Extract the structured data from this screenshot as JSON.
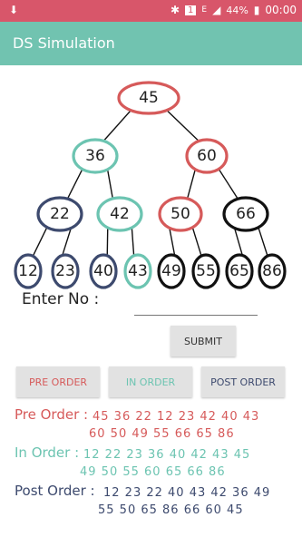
{
  "status_bar": {
    "sim_badge": "1",
    "network": "E",
    "battery": "44%",
    "time": "00:00"
  },
  "app": {
    "title": "DS Simulation"
  },
  "colors": {
    "status": "#d8566a",
    "app_bar": "#71c3b0",
    "red": "#d65a5a",
    "teal": "#6cc4b1",
    "navy": "#3d4a6e",
    "black": "#111111"
  },
  "tree": {
    "nodes": [
      {
        "value": "45",
        "color": "red"
      },
      {
        "value": "36",
        "color": "teal"
      },
      {
        "value": "60",
        "color": "red"
      },
      {
        "value": "22",
        "color": "navy"
      },
      {
        "value": "42",
        "color": "teal"
      },
      {
        "value": "50",
        "color": "red"
      },
      {
        "value": "66",
        "color": "black"
      },
      {
        "value": "12",
        "color": "navy"
      },
      {
        "value": "23",
        "color": "navy"
      },
      {
        "value": "40",
        "color": "navy"
      },
      {
        "value": "43",
        "color": "teal"
      },
      {
        "value": "49",
        "color": "black"
      },
      {
        "value": "55",
        "color": "black"
      },
      {
        "value": "65",
        "color": "black"
      },
      {
        "value": "86",
        "color": "black"
      }
    ]
  },
  "form": {
    "enter_label": "Enter No :",
    "input_value": "",
    "submit_label": "SUBMIT"
  },
  "buttons": {
    "pre_order": "PRE ORDER",
    "in_order": "IN ORDER",
    "post_order": "POST ORDER"
  },
  "results": {
    "pre_label": "Pre Order :",
    "pre_line1": "45 36 22 12 23 42 40 43",
    "pre_line2": "60 50 49 55 66 65 86",
    "in_label": "In Order :",
    "in_line1": "12 22 23 36 40 42 43 45",
    "in_line2": "49 50 55 60 65 66 86",
    "post_label": "Post Order :",
    "post_line1": "12 23 22 40 43 42 36 49",
    "post_line2": "55 50 65 86 66 60 45"
  }
}
